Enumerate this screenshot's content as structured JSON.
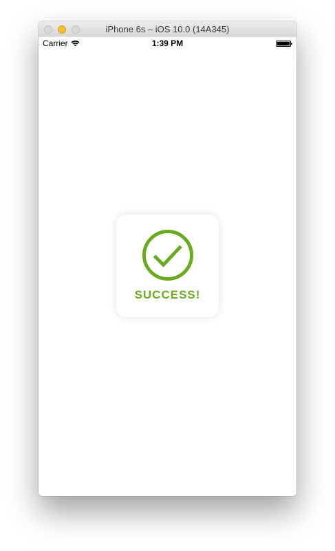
{
  "window": {
    "title": "iPhone 6s – iOS 10.0 (14A345)"
  },
  "status_bar": {
    "carrier": "Carrier",
    "time": "1:39 PM"
  },
  "hud": {
    "message": "SUCCESS!",
    "icon": "checkmark-circle-icon",
    "accent_color": "#6aaa1f"
  }
}
